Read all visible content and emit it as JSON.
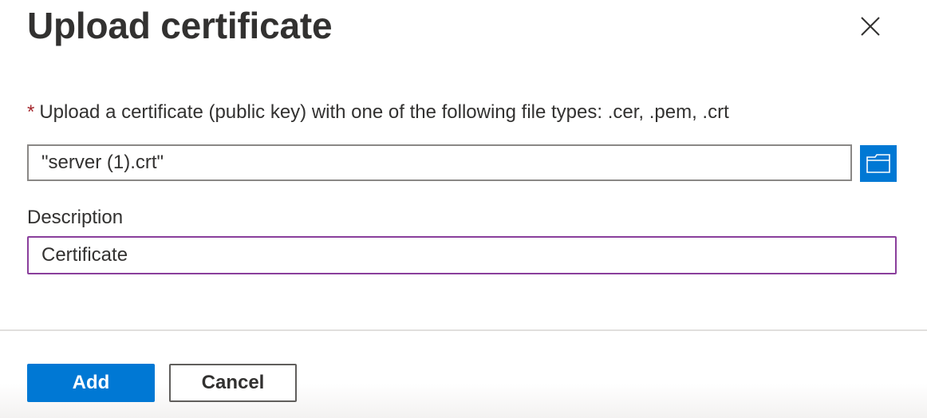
{
  "dialog": {
    "title": "Upload certificate",
    "close_icon": "close-icon"
  },
  "upload": {
    "required_marker": "*",
    "label": "Upload a certificate (public key) with one of the following file types: .cer, .pem, .crt",
    "file_value": "\"server (1).crt\"",
    "browse_icon": "folder-icon"
  },
  "description": {
    "label": "Description",
    "value": "Certificate"
  },
  "footer": {
    "add_label": "Add",
    "cancel_label": "Cancel"
  },
  "colors": {
    "accent": "#0078d4",
    "required": "#a4262c",
    "focus_border": "#8a3f9c"
  }
}
